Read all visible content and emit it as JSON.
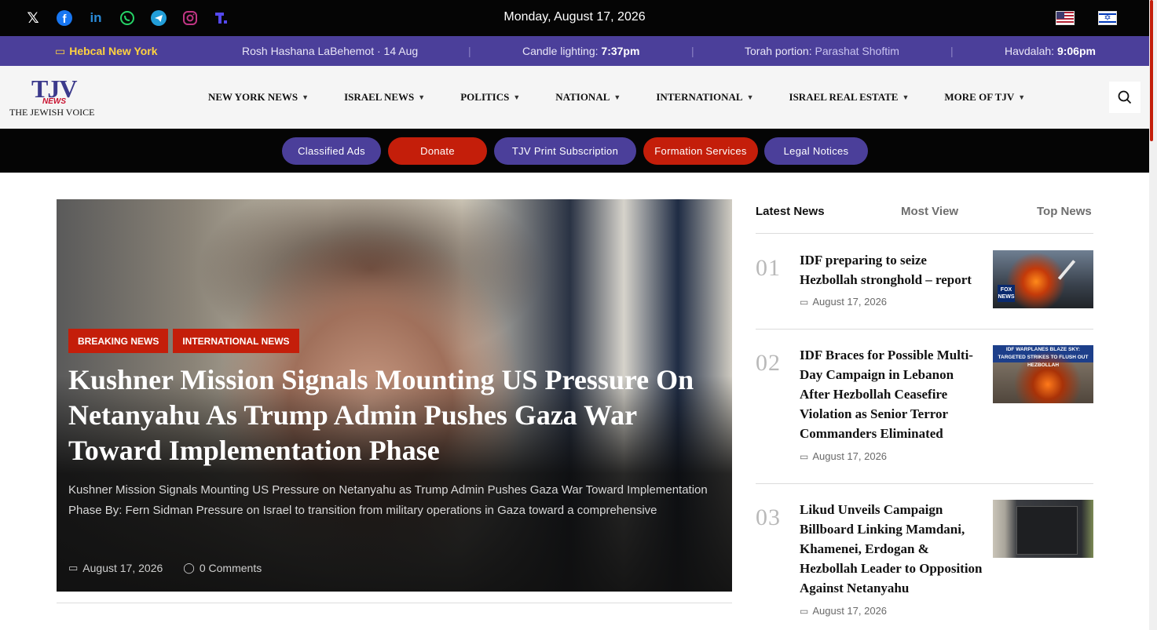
{
  "top": {
    "date": "Monday, August 17, 2026",
    "social_icons": [
      "x-icon",
      "facebook-icon",
      "linkedin-icon",
      "whatsapp-icon",
      "telegram-icon",
      "instagram-icon",
      "truth-social-icon"
    ],
    "flags": [
      "us-flag-icon",
      "israel-flag-icon"
    ]
  },
  "calendar": {
    "location": "Hebcal New York",
    "holiday": "Rosh Hashana LaBehemot · 14 Aug",
    "candle_label": "Candle lighting: ",
    "candle_time": "7:37pm",
    "torah_label": "Torah portion: ",
    "torah_portion": "Parashat Shoftim",
    "havdalah_label": "Havdalah: ",
    "havdalah_time": "9:06pm"
  },
  "logo": {
    "mark": "TJV",
    "news": "NEWS",
    "name": "THE JEWISH VOICE"
  },
  "nav": [
    "NEW YORK NEWS",
    "ISRAEL NEWS",
    "POLITICS",
    "NATIONAL",
    "INTERNATIONAL",
    "ISRAEL REAL ESTATE",
    "MORE OF TJV"
  ],
  "pills": [
    {
      "label": "Classified Ads",
      "color": "#4b3f9a"
    },
    {
      "label": "Donate",
      "color": "#c41e0a"
    },
    {
      "label": "TJV Print Subscription",
      "color": "#4b3f9a"
    },
    {
      "label": "Formation Services",
      "color": "#c41e0a"
    },
    {
      "label": "Legal Notices",
      "color": "#4b3f9a"
    }
  ],
  "hero": {
    "tags": [
      "BREAKING NEWS",
      "INTERNATIONAL NEWS"
    ],
    "title": "Kushner Mission Signals Mounting US Pressure On Netanyahu As Trump Admin Pushes Gaza War Toward Implementation Phase",
    "excerpt": "Kushner Mission Signals Mounting US Pressure on Netanyahu as Trump Admin Pushes Gaza War Toward Implementation Phase   By: Fern Sidman Pressure on Israel to transition from military operations in Gaza toward a comprehensive",
    "date": "August 17, 2026",
    "comments": "0 Comments"
  },
  "sidebar": {
    "tabs": [
      "Latest News",
      "Most View",
      "Top News"
    ],
    "items": [
      {
        "num": "01",
        "title": "IDF preparing to seize Hezbollah stronghold – report",
        "date": "August 17, 2026"
      },
      {
        "num": "02",
        "title": "IDF Braces for Possible Multi-Day Campaign in Lebanon After Hezbollah Ceasefire Violation as Senior Terror Commanders Eliminated",
        "date": "August 17, 2026",
        "thumb_caption": "IDF WARPLANES BLAZE SKY: TARGETED STRIKES TO FLUSH OUT HEZBOLLAH"
      },
      {
        "num": "03",
        "title": "Likud Unveils Campaign Billboard Linking Mamdani, Khamenei, Erdogan & Hezbollah Leader to Opposition Against Netanyahu",
        "date": "August 17, 2026"
      }
    ]
  },
  "colors": {
    "brand_purple": "#4b3f9a",
    "brand_red": "#c41e0a",
    "hebcal_yellow": "#ffd23f"
  }
}
